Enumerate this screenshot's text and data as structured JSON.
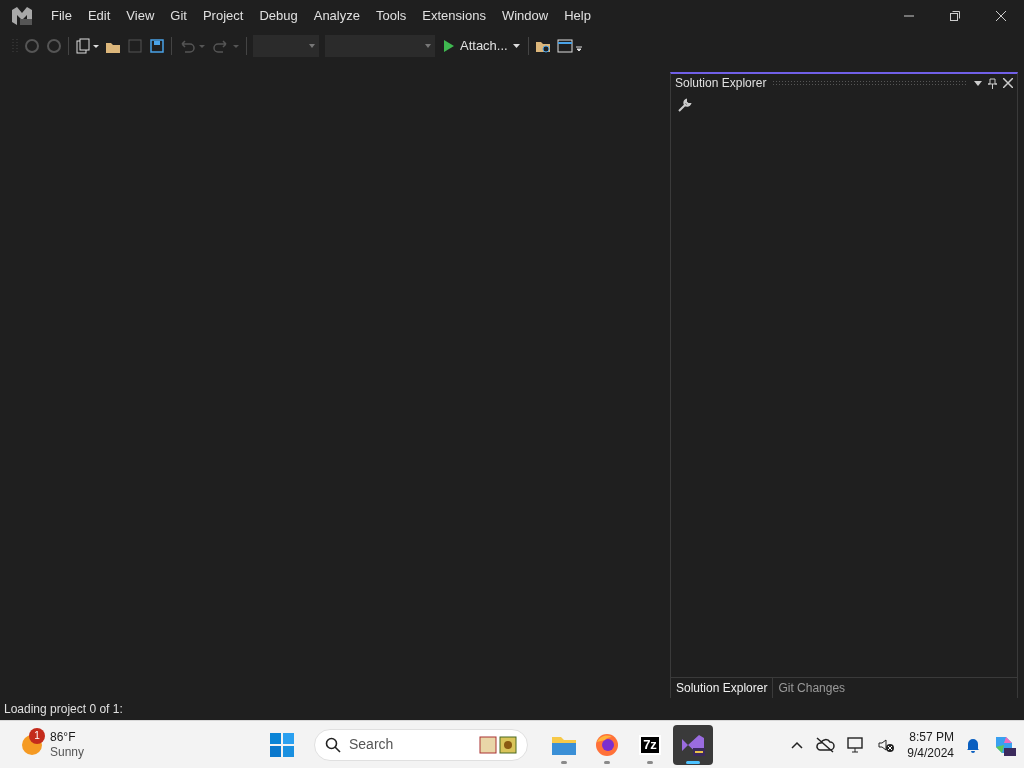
{
  "menu": [
    "File",
    "Edit",
    "View",
    "Git",
    "Project",
    "Debug",
    "Analyze",
    "Tools",
    "Extensions",
    "Window",
    "Help"
  ],
  "toolbar": {
    "attach_label": "Attach..."
  },
  "solution_explorer": {
    "title": "Solution Explorer"
  },
  "bottom_tabs": [
    {
      "label": "Solution Explorer",
      "selected": true
    },
    {
      "label": "Git Changes",
      "selected": false
    }
  ],
  "status_bar": {
    "text": "Loading project 0 of 1:"
  },
  "taskbar": {
    "weather": {
      "badge": "1",
      "temperature": "86°F",
      "condition": "Sunny"
    },
    "search": {
      "placeholder": "Search"
    },
    "apps": [
      {
        "kind": "files",
        "active": false
      },
      {
        "kind": "browser",
        "active": false
      },
      {
        "kind": "archiver",
        "label": "7z",
        "active": false
      },
      {
        "kind": "ide",
        "active": true
      }
    ],
    "clock": {
      "time": "8:57 PM",
      "date": "9/4/2024"
    }
  }
}
